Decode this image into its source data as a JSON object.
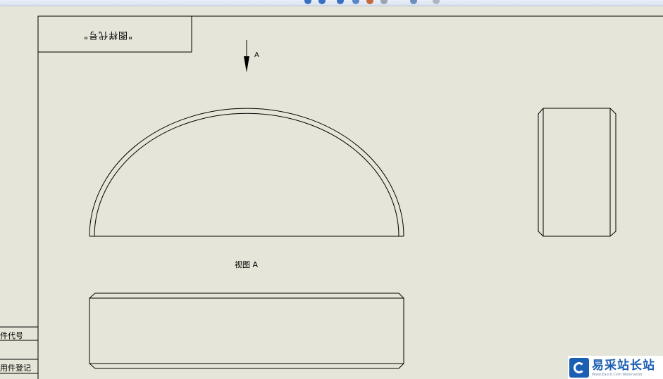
{
  "title_block": {
    "drawing_label": "\"图样代号\""
  },
  "view": {
    "arrow_label": "A",
    "view_caption": "视图 A"
  },
  "side_panel": {
    "part_code_label": "件代号",
    "part_register_label": "用件登记"
  },
  "watermark": {
    "name": "易采站长站",
    "url": "Www.Easck.Com Webmaster",
    "logo_icon": "easck-logo-icon"
  },
  "colors": {
    "background": "#e6e5d9",
    "line": "#000000",
    "watermark_blue": "#1b5fb3"
  }
}
